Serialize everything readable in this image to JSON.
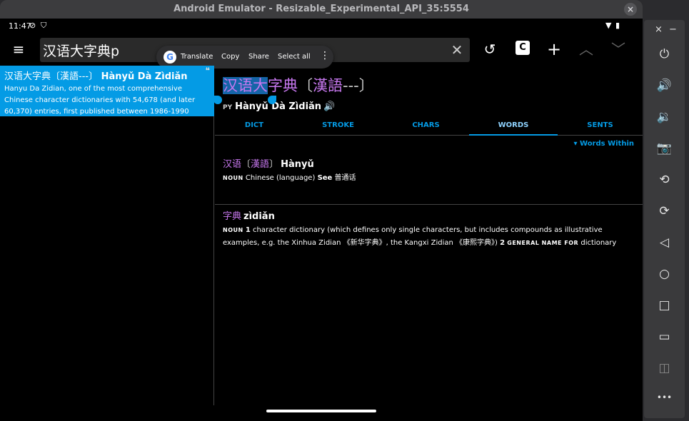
{
  "window": {
    "title": "Android Emulator - Resizable_Experimental_API_35:5554",
    "close_label": "×"
  },
  "status": {
    "time": "11:47",
    "icons_left": [
      "do-not-disturb-icon",
      "vpn-icon"
    ],
    "icons_right": [
      "wifi-icon",
      "battery-icon"
    ]
  },
  "toolbar": {
    "menu_icon": "≡",
    "search_value": "汉语大字典p",
    "clear_icon": "✕",
    "history_icon": "↺",
    "clipboard_label": "C",
    "add_icon": "+",
    "up_icon": "︿",
    "down_icon": "﹀"
  },
  "popup": {
    "google_label": "G",
    "translate": "Translate",
    "copy": "Copy",
    "share": "Share",
    "select_all": "Select all",
    "more": "⋮"
  },
  "result": {
    "headword_zh": "汉语大字典〔漢語---〕",
    "headword_py": "Hànyǔ Dà Zìdiǎn",
    "description": "Hanyu Da Zidian, one of the most comprehensive Chinese character dictionaries with 54,678 (and later 60,370) entries, first published between 1986-1990",
    "quote_icon": "❝"
  },
  "bottom": {
    "brush_icon": "🖌",
    "keyboard_icon": "⌨",
    "mic_icon": "🎙"
  },
  "detail": {
    "headword_sel": "汉语大",
    "headword_rest": "字典",
    "headword_open": "〔",
    "headword_trad": "漢語",
    "headword_dash": "---",
    "headword_close": "〕",
    "py_tag": "PY",
    "pinyin": "Hànyǔ Dà Zìdiǎn",
    "speaker_icon": "🔊",
    "tabs": [
      "DICT",
      "STROKE",
      "CHARS",
      "WORDS",
      "SENTS"
    ],
    "active_tab": "WORDS",
    "words_within": "▾ Words Within",
    "entries": [
      {
        "zs": "汉语",
        "open": "〔",
        "zt": "漢語",
        "close": "〕",
        "py": "Hànyǔ",
        "pos": "NOUN",
        "def": "Chinese (language)",
        "see_label": "See",
        "see": "普通话"
      },
      {
        "zs": "字典",
        "py": "zìdiǎn",
        "pos": "NOUN",
        "n1": "1",
        "def1": "character dictionary (which defines only single characters, but includes compounds as illustrative examples, e.g. the Xinhua Zidian 《新华字典》, the Kangxi Zidian 《康熙字典》)",
        "n2": "2",
        "pos2": "GENERAL NAME FOR",
        "def2": "dictionary"
      }
    ]
  },
  "sidebar": {
    "close": "×",
    "minimize": "−",
    "power": "⏻",
    "vol_up": "🔊",
    "vol_down": "🔉",
    "camera": "📷",
    "rotate_left": "⟲",
    "rotate_right": "⟳",
    "back": "◁",
    "home": "○",
    "overview": "□",
    "fold": "▭",
    "unfold": "◫",
    "more": "•••"
  }
}
